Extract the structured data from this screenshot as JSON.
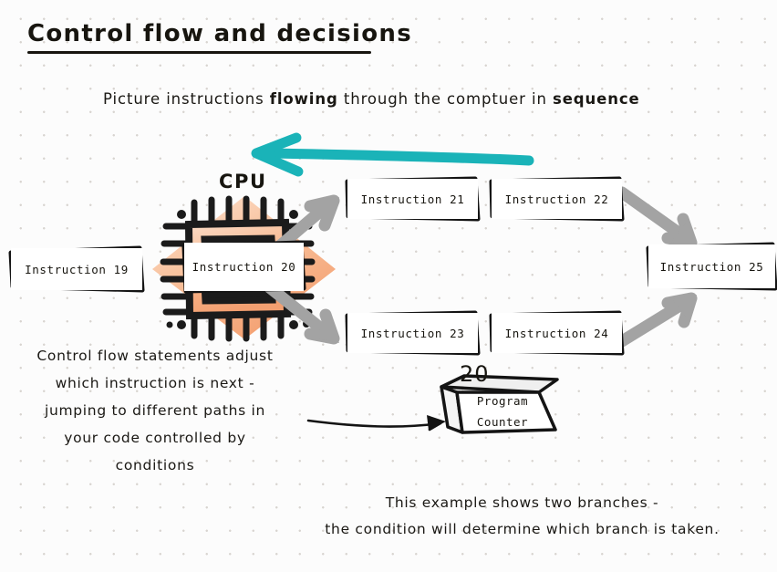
{
  "page": {
    "title": "Control flow and decisions",
    "subtitle_parts": [
      {
        "text": "Picture instructions ",
        "bold": false
      },
      {
        "text": "flowing",
        "bold": true
      },
      {
        "text": " through the comptuer in ",
        "bold": false
      },
      {
        "text": "sequence",
        "bold": true
      }
    ],
    "subtitle_plain": "Picture instructions flowing through the comptuer in sequence"
  },
  "colors": {
    "ink": "#17150f",
    "teal_arrow": "#1ab3b8",
    "gray_arrow": "#a3a3a3",
    "cpu_diamond_light": "#fbe0cd",
    "cpu_diamond_dark": "#f6a878",
    "page_background": "#fcfcfc",
    "dot_grid": "#d8d4d0"
  },
  "cpu": {
    "label": "CPU",
    "current_instruction": "Instruction 20"
  },
  "instructions": {
    "previous": "Instruction 19",
    "branch_a": [
      "Instruction 21",
      "Instruction 22"
    ],
    "branch_b": [
      "Instruction 23",
      "Instruction 24"
    ],
    "merge": "Instruction 25"
  },
  "program_counter": {
    "value": "20",
    "label_line1": "Program",
    "label_line2": "Counter"
  },
  "captions": {
    "left": "Control flow statements adjust which instruction is next - jumping to different paths in your code controlled by conditions",
    "left_lines": [
      "Control flow statements adjust",
      "which instruction is next -",
      "jumping to different paths in",
      "your code controlled by",
      "conditions"
    ],
    "bottom": "This example shows two branches - the condition will determine which branch is taken.",
    "bottom_lines": [
      "This example shows two branches -",
      "the condition will determine which branch is taken."
    ]
  },
  "arrows": {
    "feedback_loop": "teal-arrow-pointing-left",
    "branch_up": "gray-arrow-cpu-to-instruction-21",
    "branch_down": "gray-arrow-cpu-to-instruction-23",
    "merge_down": "gray-arrow-instruction-22-to-25",
    "merge_up": "gray-arrow-instruction-24-to-25",
    "pc_pointer": "thin-black-arrow-to-program-counter"
  }
}
